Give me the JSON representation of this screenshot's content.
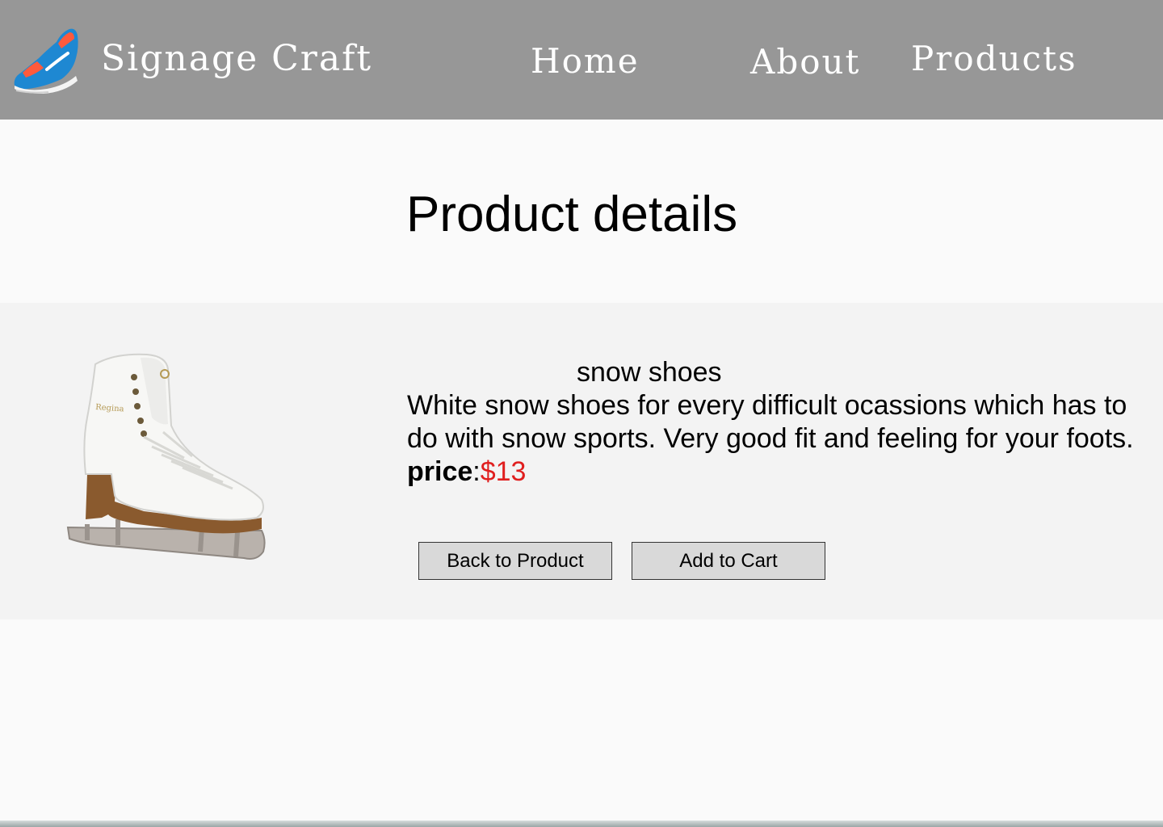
{
  "header": {
    "brand_name": "Signage Craft",
    "logo_icon": "sneaker-logo-icon",
    "nav": {
      "home": "Home",
      "about": "About",
      "products": "Products"
    },
    "background": "#979797"
  },
  "main": {
    "title": "Product details"
  },
  "product": {
    "image_icon": "ice-skate-image",
    "name": "snow shoes",
    "description": "White snow shoes for every difficult ocassions which has to do with snow sports. Very good fit and feeling for your foots.",
    "price_label": "price",
    "price_separator": ":",
    "price": "$13",
    "price_color": "#e01e1e"
  },
  "actions": {
    "back_label": "Back to Product",
    "cart_label": "Add to Cart"
  }
}
